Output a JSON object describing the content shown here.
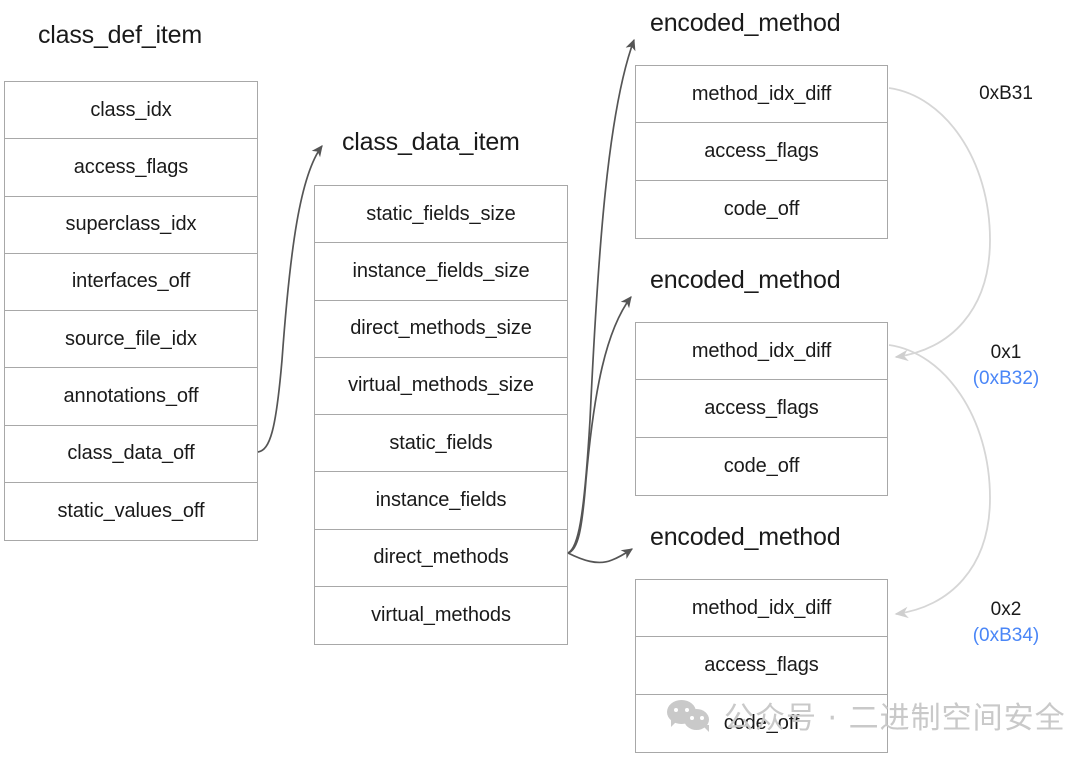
{
  "diagram": {
    "title_class_def": "class_def_item",
    "title_class_data": "class_data_item",
    "title_encoded_method": "encoded_method"
  },
  "class_def_item": {
    "title": "class_def_item",
    "rows": [
      "class_idx",
      "access_flags",
      "superclass_idx",
      "interfaces_off",
      "source_file_idx",
      "annotations_off",
      "class_data_off",
      "static_values_off"
    ]
  },
  "class_data_item": {
    "title": "class_data_item",
    "rows": [
      "static_fields_size",
      "instance_fields_size",
      "direct_methods_size",
      "virtual_methods_size",
      "static_fields",
      "instance_fields",
      "direct_methods",
      "virtual_methods"
    ]
  },
  "encoded_methods": [
    {
      "title": "encoded_method",
      "rows": [
        "method_idx_diff",
        "access_flags",
        "code_off"
      ],
      "annotation_primary": "0xB31",
      "annotation_secondary": ""
    },
    {
      "title": "encoded_method",
      "rows": [
        "method_idx_diff",
        "access_flags",
        "code_off"
      ],
      "annotation_primary": "0x1",
      "annotation_secondary": "(0xB32)"
    },
    {
      "title": "encoded_method",
      "rows": [
        "method_idx_diff",
        "access_flags",
        "code_off"
      ],
      "annotation_primary": "0x2",
      "annotation_secondary": "(0xB34)"
    }
  ],
  "watermark": {
    "text": "公众号 · 二进制空间安全",
    "icon": "wechat-icon"
  },
  "colors": {
    "border": "#a8a8a8",
    "text": "#1a1a1a",
    "accent_blue": "#4a86f7",
    "arrow_dark": "#555555",
    "arrow_light": "#d3d3d3",
    "watermark": "#c9c9c9"
  }
}
